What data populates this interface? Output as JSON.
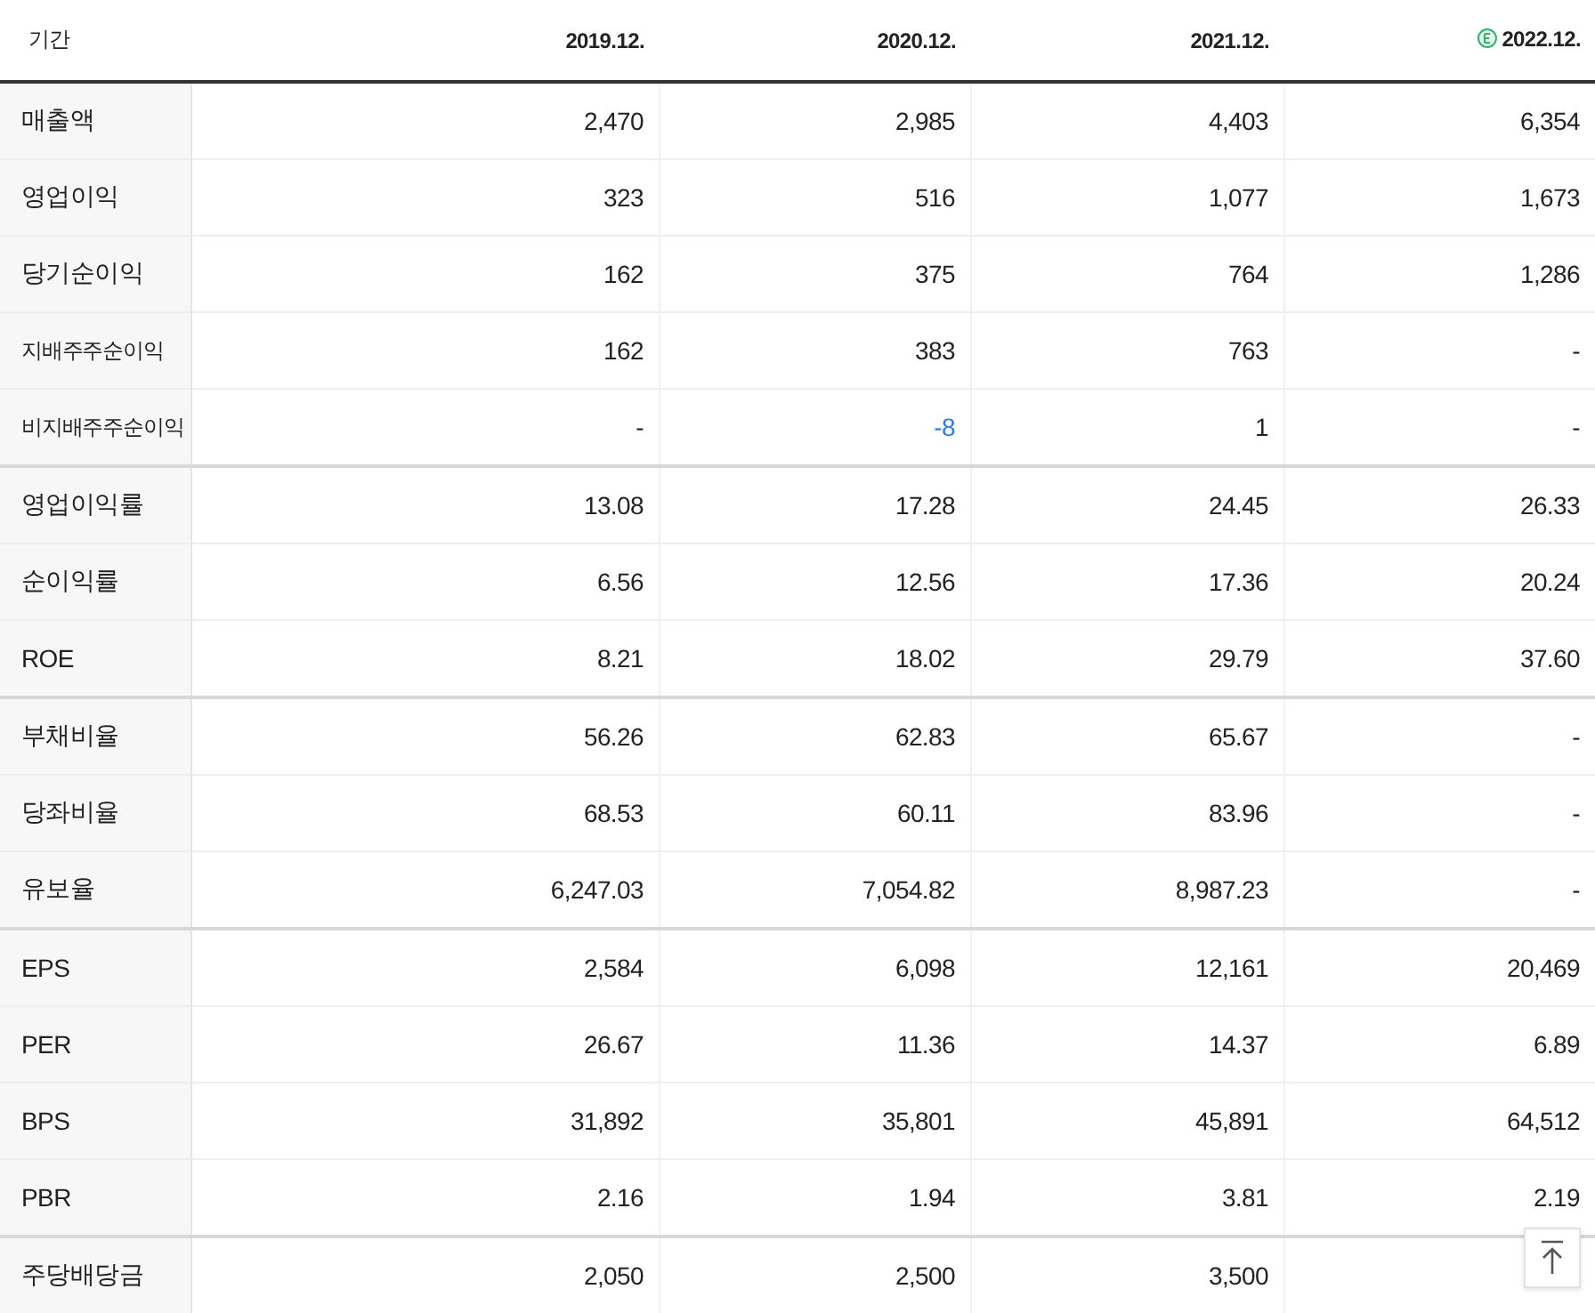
{
  "table": {
    "header_label": "기간",
    "columns": [
      {
        "label": "2019.12.",
        "estimate": false
      },
      {
        "label": "2020.12.",
        "estimate": false
      },
      {
        "label": "2021.12.",
        "estimate": false
      },
      {
        "label": "2022.12.",
        "estimate": true
      }
    ],
    "rows": [
      {
        "label": "매출액",
        "group_start": false,
        "small": false,
        "cells": [
          "2,470",
          "2,985",
          "4,403",
          "6,354"
        ]
      },
      {
        "label": "영업이익",
        "group_start": false,
        "small": false,
        "cells": [
          "323",
          "516",
          "1,077",
          "1,673"
        ]
      },
      {
        "label": "당기순이익",
        "group_start": false,
        "small": false,
        "cells": [
          "162",
          "375",
          "764",
          "1,286"
        ]
      },
      {
        "label": "지배주주순이익",
        "group_start": false,
        "small": true,
        "cells": [
          "162",
          "383",
          "763",
          "-"
        ]
      },
      {
        "label": "비지배주주순이익",
        "group_start": false,
        "small": true,
        "cells": [
          "-",
          {
            "text": "-8",
            "negative": true
          },
          "1",
          "-"
        ]
      },
      {
        "label": "영업이익률",
        "group_start": true,
        "small": false,
        "cells": [
          "13.08",
          "17.28",
          "24.45",
          "26.33"
        ]
      },
      {
        "label": "순이익률",
        "group_start": false,
        "small": false,
        "cells": [
          "6.56",
          "12.56",
          "17.36",
          "20.24"
        ]
      },
      {
        "label": "ROE",
        "group_start": false,
        "small": false,
        "cells": [
          "8.21",
          "18.02",
          "29.79",
          "37.60"
        ]
      },
      {
        "label": "부채비율",
        "group_start": true,
        "small": false,
        "cells": [
          "56.26",
          "62.83",
          "65.67",
          "-"
        ]
      },
      {
        "label": "당좌비율",
        "group_start": false,
        "small": false,
        "cells": [
          "68.53",
          "60.11",
          "83.96",
          "-"
        ]
      },
      {
        "label": "유보율",
        "group_start": false,
        "small": false,
        "cells": [
          "6,247.03",
          "7,054.82",
          "8,987.23",
          "-"
        ]
      },
      {
        "label": "EPS",
        "group_start": true,
        "small": false,
        "cells": [
          "2,584",
          "6,098",
          "12,161",
          "20,469"
        ]
      },
      {
        "label": "PER",
        "group_start": false,
        "small": false,
        "cells": [
          "26.67",
          "11.36",
          "14.37",
          "6.89"
        ]
      },
      {
        "label": "BPS",
        "group_start": false,
        "small": false,
        "cells": [
          "31,892",
          "35,801",
          "45,891",
          "64,512"
        ]
      },
      {
        "label": "PBR",
        "group_start": false,
        "small": false,
        "cells": [
          "2.16",
          "1.94",
          "3.81",
          "2.19"
        ]
      },
      {
        "label": "주당배당금",
        "group_start": true,
        "small": false,
        "cells": [
          "2,050",
          "2,500",
          "3,500"
        ]
      }
    ]
  }
}
